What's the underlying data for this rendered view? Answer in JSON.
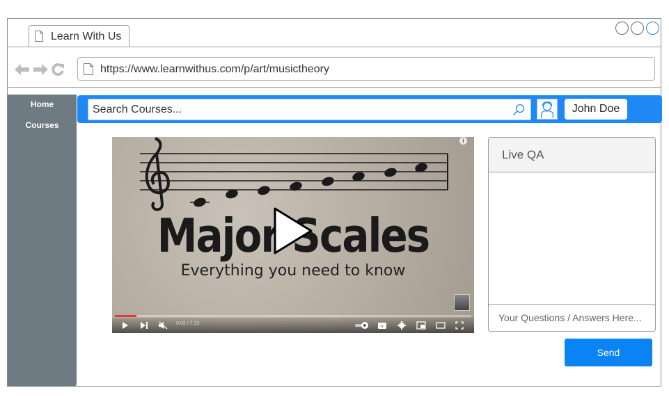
{
  "window": {
    "tab_title": "Learn With Us",
    "url": "https://www.learnwithus.com/p/art/musictheory"
  },
  "sidebar": {
    "items": [
      {
        "label": "Home"
      },
      {
        "label": "Courses"
      }
    ]
  },
  "header": {
    "search_placeholder": "Search Courses...",
    "user_name": "John Doe",
    "accent_color": "#1e88f5"
  },
  "video": {
    "title": "Major Scales",
    "subtitle": "Everything you need to know",
    "time": "0:02 / 7:13",
    "progress": 0.005
  },
  "qa": {
    "title": "Live QA",
    "input_placeholder": "Your Questions / Answers Here...",
    "send_label": "Send"
  }
}
